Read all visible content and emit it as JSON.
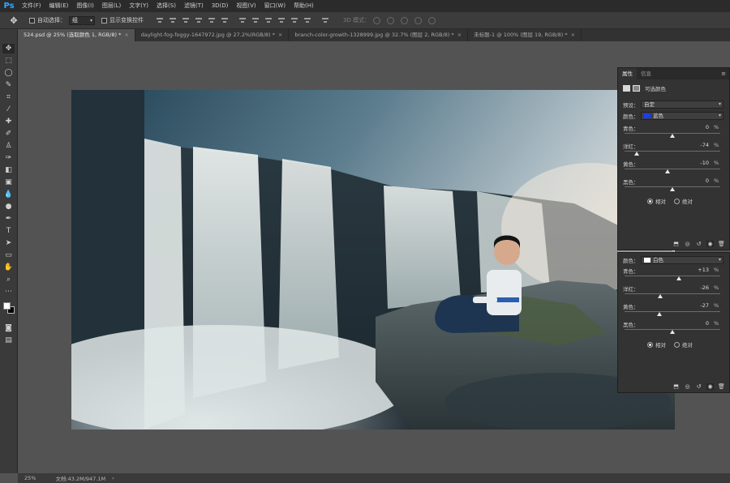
{
  "app": {
    "logo": "Ps"
  },
  "menu": [
    "文件(F)",
    "编辑(E)",
    "图像(I)",
    "图层(L)",
    "文字(Y)",
    "选择(S)",
    "滤镜(T)",
    "3D(D)",
    "视图(V)",
    "窗口(W)",
    "帮助(H)"
  ],
  "options": {
    "auto_select_label": "自动选择：",
    "auto_select_value": "组",
    "show_transform_label": "显示变换控件",
    "mode_3d_label": "3D 模式："
  },
  "tabs": [
    {
      "label": "524.psd @ 25% (选取颜色 1, RGB/8) *",
      "close": "×"
    },
    {
      "label": "daylight-fog-foggy-1647972.jpg @ 27.2%(RGB/8) *",
      "close": "×"
    },
    {
      "label": "branch-color-growth-1328999.jpg @ 32.7% (图层 2, RGB/8) *",
      "close": "×"
    },
    {
      "label": "未标题-1 @ 100% (图层 19, RGB/8) *",
      "close": "×"
    }
  ],
  "panel1": {
    "tabs": [
      "属性",
      "信息"
    ],
    "menu_icon": "≡",
    "title": "可选颜色",
    "preset_label": "预设：",
    "preset_value": "自定",
    "color_label": "颜色：",
    "color_value": "蓝色",
    "color_swatch": "#1a3cff",
    "sliders": [
      {
        "label": "青色：",
        "value": "0",
        "pct": "%",
        "level": 0
      },
      {
        "label": "洋红：",
        "value": "-74",
        "pct": "%",
        "level": -74
      },
      {
        "label": "黄色：",
        "value": "-10",
        "pct": "%",
        "level": -10
      },
      {
        "label": "黑色：",
        "value": "0",
        "pct": "%",
        "level": 0
      }
    ],
    "radio_relative": "相对",
    "radio_absolute": "绝对"
  },
  "panel2": {
    "color_label": "颜色：",
    "color_value": "白色",
    "color_swatch": "#ffffff",
    "sliders": [
      {
        "label": "青色：",
        "value": "+13",
        "pct": "%",
        "level": 13
      },
      {
        "label": "洋红：",
        "value": "-26",
        "pct": "%",
        "level": -26
      },
      {
        "label": "黄色：",
        "value": "-27",
        "pct": "%",
        "level": -27
      },
      {
        "label": "黑色：",
        "value": "0",
        "pct": "%",
        "level": 0
      }
    ],
    "radio_relative": "相对",
    "radio_absolute": "绝对"
  },
  "status": {
    "zoom": "25%",
    "doc": "文档:43.2M/947.1M",
    "arrow": "›"
  }
}
